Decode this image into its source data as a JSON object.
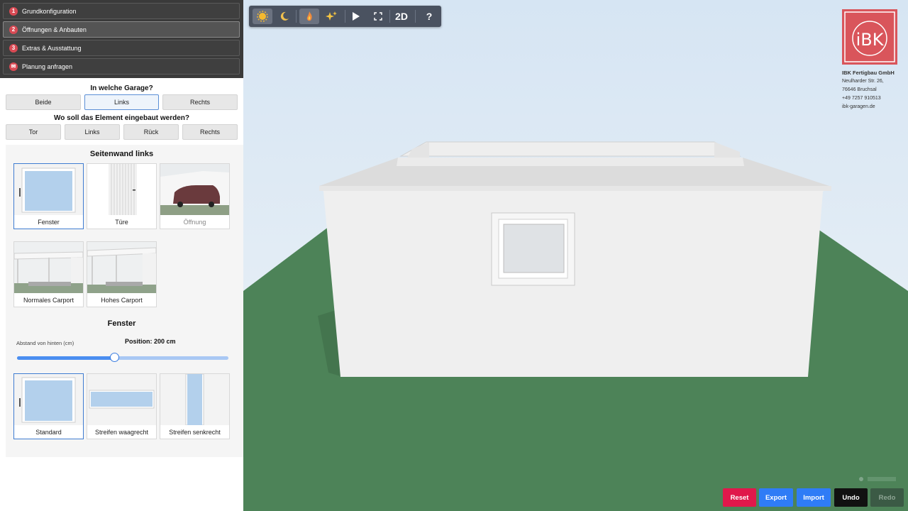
{
  "steps": [
    {
      "num": "1",
      "label": "Grundkonfiguration"
    },
    {
      "num": "2",
      "label": "Öffnungen & Anbauten"
    },
    {
      "num": "3",
      "label": "Extras & Ausstattung"
    },
    {
      "num": "✉",
      "label": "Planung anfragen"
    }
  ],
  "garage_question": "In welche Garage?",
  "garage_options": [
    "Beide",
    "Links",
    "Rechts"
  ],
  "garage_selected": "Links",
  "element_question": "Wo soll das Element eingebaut werden?",
  "element_options": [
    "Tor",
    "Links",
    "Rück",
    "Rechts"
  ],
  "wall_title": "Seitenwand links",
  "wall_elements": [
    {
      "label": "Fenster",
      "icon": "window-thumb",
      "selected": true,
      "disabled": false
    },
    {
      "label": "Türe",
      "icon": "door-thumb",
      "selected": false,
      "disabled": false
    },
    {
      "label": "Öffnung",
      "icon": "opening-van-thumb",
      "selected": false,
      "disabled": true
    },
    {
      "label": "Normales Carport",
      "icon": "carport-thumb",
      "selected": false,
      "disabled": false
    },
    {
      "label": "Hohes Carport",
      "icon": "high-carport-thumb",
      "selected": false,
      "disabled": false
    }
  ],
  "window_title": "Fenster",
  "slider": {
    "label": "Abstand von hinten (cm)",
    "position_label": "Position:",
    "value_text": "200 cm",
    "fraction": 0.46
  },
  "window_types": [
    {
      "label": "Standard",
      "selected": true
    },
    {
      "label": "Streifen waagrecht",
      "selected": false
    },
    {
      "label": "Streifen senkrecht",
      "selected": false
    }
  ],
  "toolbar": {
    "buttons": [
      "sun-icon",
      "moon-icon",
      "flame-icon",
      "sparkle-icon",
      "play-icon",
      "fullscreen-icon",
      "2D",
      "?"
    ],
    "active": [
      "sun-icon",
      "flame-icon"
    ]
  },
  "company": {
    "name": "IBK Fertigbau GmbH",
    "street": "Neulharder Str. 26,",
    "city": "76646 Bruchsal",
    "phone": "+49 7257 910513",
    "web": "ibk-garagen.de"
  },
  "actions": [
    {
      "label": "Reset",
      "color": "#e0184b"
    },
    {
      "label": "Export",
      "color": "#2f7cf6"
    },
    {
      "label": "Import",
      "color": "#2f7cf6"
    },
    {
      "label": "Undo",
      "color": "#111111"
    },
    {
      "label": "Redo",
      "color": "#3b5a45"
    }
  ],
  "colors": {
    "accent": "#d94a54",
    "selection": "#3f7cd1",
    "ground": "#4d8358",
    "sky_top": "#d7e6f3"
  }
}
